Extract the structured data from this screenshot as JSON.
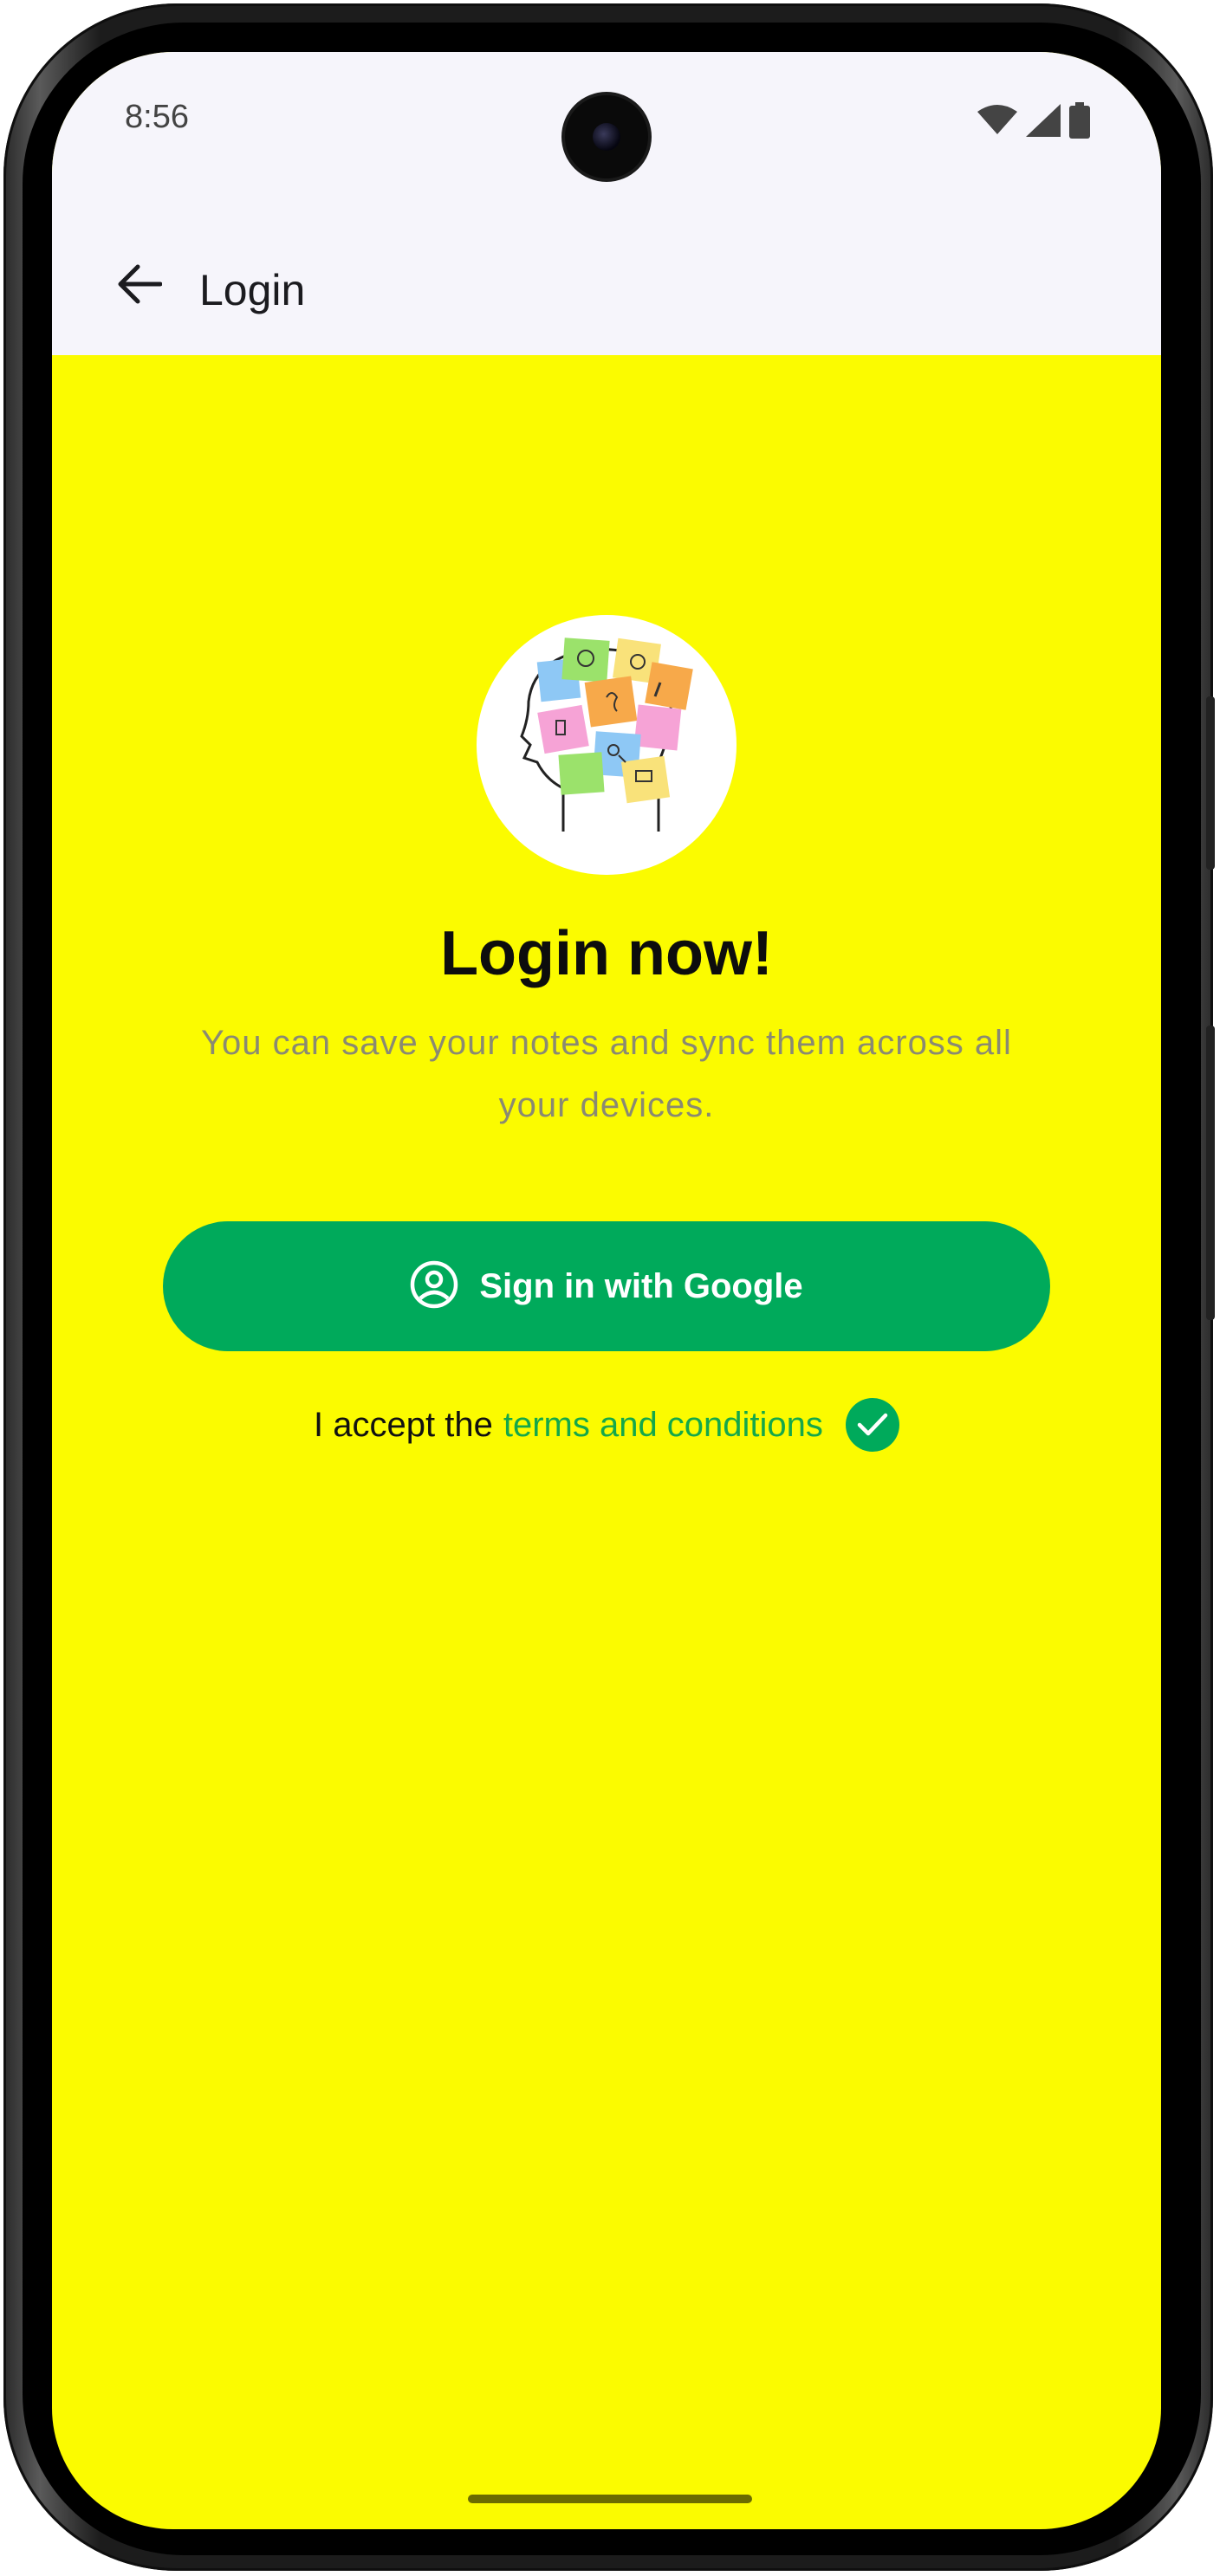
{
  "status_bar": {
    "time": "8:56",
    "icons": [
      "wifi-icon",
      "signal-icon",
      "battery-icon"
    ]
  },
  "app_bar": {
    "title": "Login",
    "back_icon": "arrow-back-icon"
  },
  "login": {
    "headline": "Login now!",
    "subtitle": "You can save your notes and sync them across all your devices.",
    "google_button": {
      "label": "Sign in with Google",
      "icon": "account-circle-icon"
    },
    "terms": {
      "prefix": "I accept the",
      "link": "terms and conditions",
      "accepted": true,
      "check_icon": "check-circle-icon"
    }
  },
  "colors": {
    "background": "#fbfb00",
    "app_bar": "#f6f5fb",
    "primary": "#00aa5b",
    "link": "#14a84a",
    "subtitle": "#8a8a72"
  }
}
